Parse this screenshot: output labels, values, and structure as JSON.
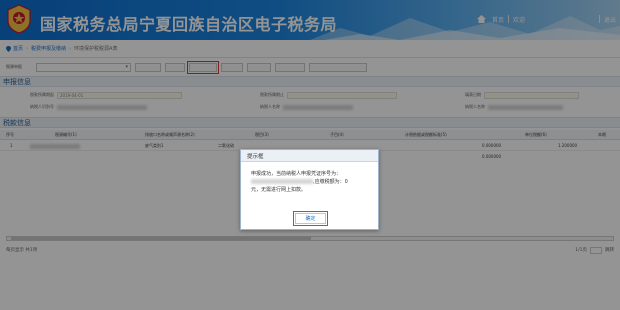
{
  "header": {
    "site_title": "国家税务总局宁夏回族自治区电子税务局",
    "home_link": "首页",
    "welcome": "欢迎",
    "logout": "退出"
  },
  "breadcrumb": {
    "items": [
      "首页",
      "税费申报及缴纳",
      "环境保护税税源A表"
    ]
  },
  "toolbar": {
    "label": "税源申报",
    "select_value": "",
    "buttons": [
      "",
      "",
      "",
      "",
      "",
      "",
      "",
      ""
    ]
  },
  "sections": {
    "declare_info": "申报信息",
    "tax_info": "税款信息"
  },
  "form": {
    "row1": {
      "label_a": "税款所属期起",
      "value_a": "2019-04-01",
      "label_b": "税款所属期止",
      "label_c": "填表日期"
    },
    "row2": {
      "label_a": "纳税人识别号",
      "label_b": "纳税人名称",
      "label_c": "纳税人名称"
    }
  },
  "grid": {
    "headers": [
      "序号",
      "税源编号(1)",
      "排放口名称或噪声源名称(2)",
      "税目(3)",
      "子目(4)",
      "计税依据或税额标准(5)",
      "单位税额(6)",
      "本期"
    ],
    "rows": [
      {
        "no": "1",
        "item": "废气类别1",
        "type": "二氧化硫",
        "value_a": "0.000000",
        "value_b": "1.200000"
      }
    ],
    "total_value": "0.000000"
  },
  "pager": {
    "left": "每页显示 共1项",
    "page_info": "1/1页",
    "go": "跳转"
  },
  "dialog": {
    "title": "提示框",
    "message_prefix": "申报成功，当前纳税人申报凭证序号为：",
    "message_mid": ",应缴税额为：0",
    "message_suffix": "元，无需进行网上扣款。",
    "ok_label": "确定"
  },
  "colors": {
    "header_start": "#0f6fd1",
    "header_end": "#a7d3f2",
    "highlight": "#d63b3b",
    "link": "#1f6fc5"
  }
}
